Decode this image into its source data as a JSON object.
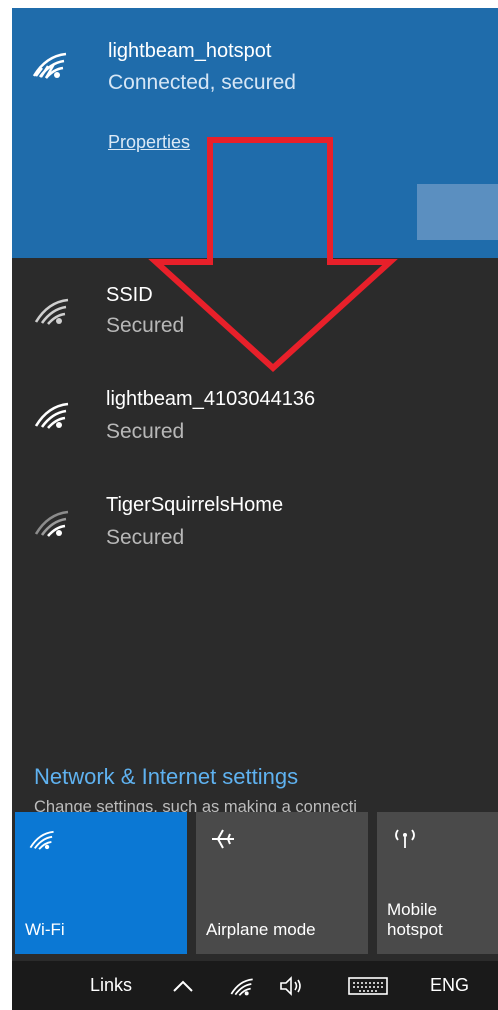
{
  "networks": [
    {
      "name": "lightbeam_hotspot",
      "status": "Connected, secured"
    },
    {
      "name": "SSID",
      "status": "Secured"
    },
    {
      "name": "lightbeam_4103044136",
      "status": "Secured"
    },
    {
      "name": "TigerSquirrelsHome",
      "status": "Secured"
    }
  ],
  "connected": {
    "properties_label": "Properties"
  },
  "settings": {
    "link": "Network & Internet settings",
    "description": "Change settings, such as making a connecti"
  },
  "quick_actions": [
    {
      "label": "Wi-Fi",
      "active": true,
      "icon": "wifi-icon"
    },
    {
      "label": "Airplane mode",
      "active": false,
      "icon": "airplane-icon"
    },
    {
      "label": "Mobile hotspot",
      "active": false,
      "icon": "mobile-hotspot-icon"
    }
  ],
  "taskbar": {
    "links_label": "Links",
    "language": "ENG"
  },
  "colors": {
    "connected_bg": "#1f6cab",
    "panel_bg": "#2b2b2b",
    "accent_link": "#5fb2f0",
    "active_tile": "#0b78d4",
    "annotation_arrow": "#e8202a"
  },
  "annotation": {
    "type": "arrow",
    "direction": "down",
    "icon": "red-arrow-annotation"
  }
}
